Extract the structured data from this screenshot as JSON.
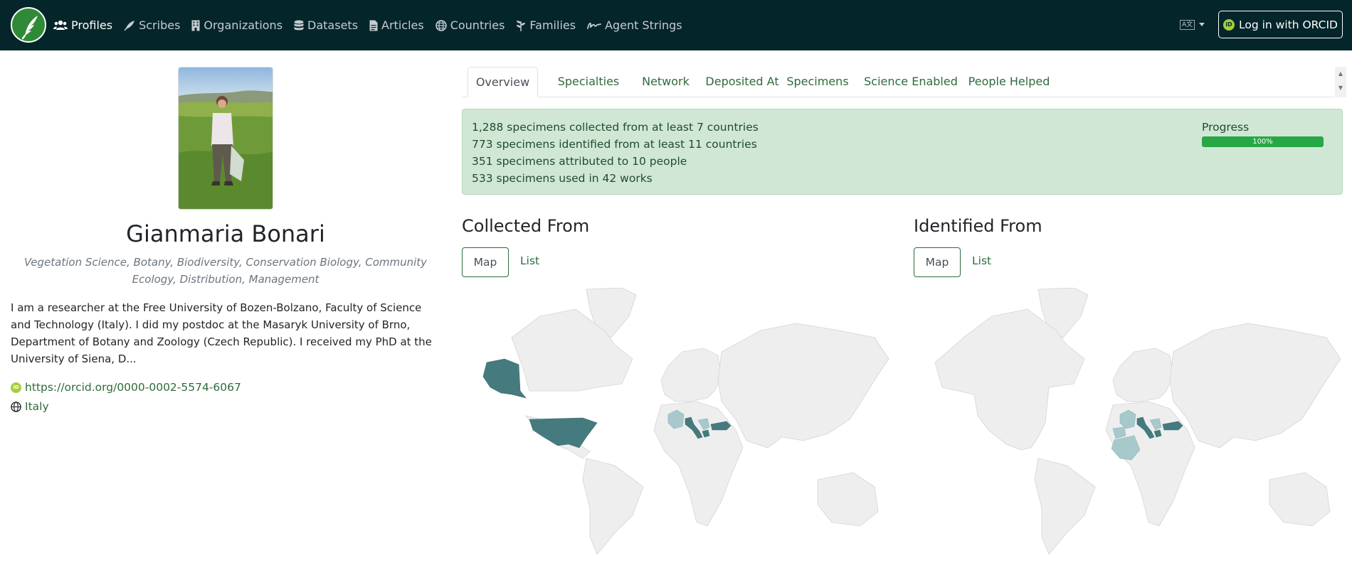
{
  "nav": {
    "items": [
      {
        "label": "Profiles",
        "icon": "users-icon",
        "active": true
      },
      {
        "label": "Scribes",
        "icon": "feather-icon",
        "active": false
      },
      {
        "label": "Organizations",
        "icon": "building-icon",
        "active": false
      },
      {
        "label": "Datasets",
        "icon": "database-icon",
        "active": false
      },
      {
        "label": "Articles",
        "icon": "file-icon",
        "active": false
      },
      {
        "label": "Countries",
        "icon": "globe-icon",
        "active": false
      },
      {
        "label": "Families",
        "icon": "plant-icon",
        "active": false
      },
      {
        "label": "Agent Strings",
        "icon": "signature-icon",
        "active": false
      }
    ],
    "login_label": "Log in with ORCID",
    "orcid_mark": "iD",
    "lang_mark": "A文"
  },
  "profile": {
    "name": "Gianmaria Bonari",
    "keywords": "Vegetation Science, Botany, Biodiversity, Conservation Biology, Community Ecology, Distribution, Management",
    "bio": "I am a researcher at the Free University of Bozen-Bolzano, Faculty of Science and Technology (Italy). I did my postdoc at the Masaryk University of Brno, Department of Botany and Zoology (Czech Republic). I received my PhD at the University of Siena, D...",
    "orcid_url": "https://orcid.org/0000-0002-5574-6067",
    "country": "Italy"
  },
  "tabs": [
    "Overview",
    "Specialties",
    "Network",
    "Deposited At",
    "Specimens",
    "Science Enabled",
    "People Helped"
  ],
  "stats": {
    "lines": [
      "1,288 specimens collected from at least 7 countries",
      "773 specimens identified from at least 11 countries",
      "351 specimens attributed to 10 people",
      "533 specimens used in 42 works"
    ],
    "progress_label": "Progress",
    "progress_value": 100,
    "progress_text": "100%"
  },
  "collected": {
    "title": "Collected From",
    "map_label": "Map",
    "list_label": "List"
  },
  "identified": {
    "title": "Identified From",
    "map_label": "Map",
    "list_label": "List"
  },
  "colors": {
    "navbar": "#04252a",
    "accent_green": "#2f6b3a",
    "alert_bg": "#d1e7d6",
    "map_dark": "#457b7e",
    "map_light": "#a7c9cc",
    "map_land": "#eeeeee"
  }
}
